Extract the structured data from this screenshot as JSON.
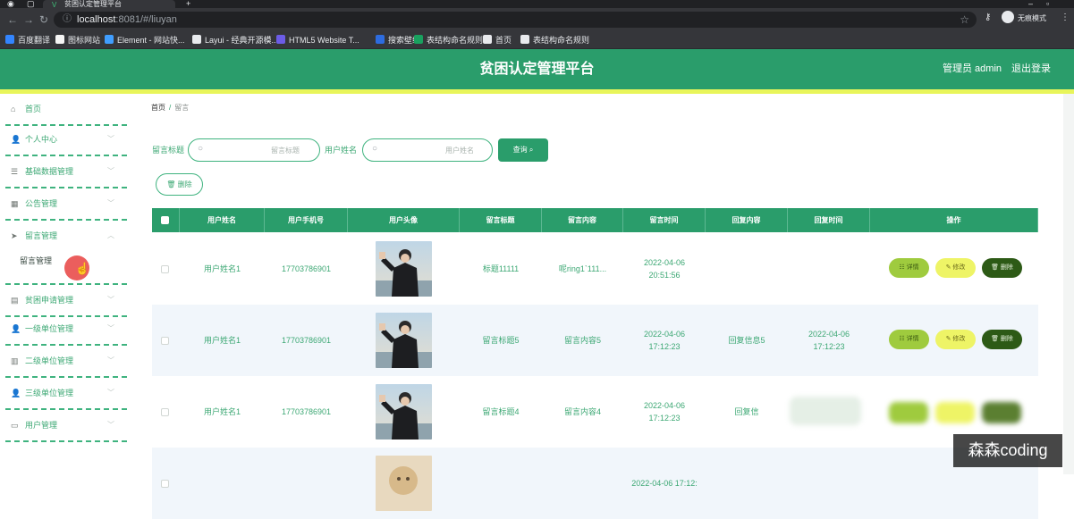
{
  "browser": {
    "tab_title": "贫困认定管理平台",
    "url_host": "localhost",
    "url_path": ":8081/#/liuyan",
    "profile_label": "无痕模式",
    "bookmarks": [
      {
        "label": "百度翻译",
        "color": "#3385ff"
      },
      {
        "label": "图标网站",
        "color": "#f5f5f5"
      },
      {
        "label": "Element - 网站快...",
        "color": "#409eff"
      },
      {
        "label": "Layui - 经典开源模...",
        "color": "#e8eaed"
      },
      {
        "label": "HTML5 Website T...",
        "color": "#6c5ce7"
      },
      {
        "label": "搜索壁纸",
        "color": "#2d6cdf"
      },
      {
        "label": "表结构命名规则",
        "color": "#19a15f"
      },
      {
        "label": "首页",
        "color": "#e8eaed"
      },
      {
        "label": "表结构命名规则",
        "color": "#e8eaed"
      }
    ]
  },
  "header": {
    "title": "贫困认定管理平台",
    "user": "管理员 admin",
    "logout": "退出登录",
    "primary_color": "#2a9d6b",
    "accent_strip_color": "#e8f55a"
  },
  "sidebar": {
    "items": [
      {
        "label": "首页",
        "icon": "home-icon",
        "glyph": "⌂",
        "has_chevron": false
      },
      {
        "label": "个人中心",
        "icon": "user-icon",
        "glyph": "👤",
        "has_chevron": true
      },
      {
        "label": "基础数据管理",
        "icon": "menu-icon",
        "glyph": "☰",
        "has_chevron": true
      },
      {
        "label": "公告管理",
        "icon": "grid-icon",
        "glyph": "▦",
        "has_chevron": true
      },
      {
        "label": "留言管理",
        "icon": "send-icon",
        "glyph": "➤",
        "has_chevron": true
      },
      {
        "label": "贫困申请管理",
        "icon": "document-icon",
        "glyph": "▤",
        "has_chevron": true
      },
      {
        "label": "一级单位管理",
        "icon": "user-icon",
        "glyph": "👤",
        "has_chevron": true
      },
      {
        "label": "二级单位管理",
        "icon": "chart-icon",
        "glyph": "▥",
        "has_chevron": true
      },
      {
        "label": "三级单位管理",
        "icon": "user-icon",
        "glyph": "👤",
        "has_chevron": true
      },
      {
        "label": "用户管理",
        "icon": "chat-icon",
        "glyph": "▭",
        "has_chevron": true
      }
    ],
    "active_sub": "留言管理"
  },
  "breadcrumb": {
    "home": "首页",
    "separator": "/",
    "current": "留言"
  },
  "search": {
    "field1_label": "留言标题",
    "field1_placeholder": "留言标题",
    "field2_label": "用户姓名",
    "field2_placeholder": "用户姓名",
    "query_button": "查询",
    "delete_button": "删除"
  },
  "table": {
    "columns": [
      "用户姓名",
      "用户手机号",
      "用户头像",
      "留言标题",
      "留言内容",
      "留言时间",
      "回复内容",
      "回复时间",
      "操作"
    ],
    "rows": [
      {
        "name": "用户姓名1",
        "phone": "17703786901",
        "title": "标题11111",
        "content": "呢ring1`111...",
        "time": "2022-04-06 20:51:56",
        "reply": "",
        "reply_time": ""
      },
      {
        "name": "用户姓名1",
        "phone": "17703786901",
        "title": "留言标题5",
        "content": "留言内容5",
        "time": "2022-04-06 17:12:23",
        "reply": "回复信息5",
        "reply_time": "2022-04-06 17:12:23"
      },
      {
        "name": "用户姓名1",
        "phone": "17703786901",
        "title": "留言标题4",
        "content": "留言内容4",
        "time": "2022-04-06 17:12:23",
        "reply": "回复信",
        "reply_time": ""
      },
      {
        "name": "",
        "phone": "",
        "title": "",
        "content": "",
        "time": "2022-04-06 17:12:",
        "reply": "",
        "reply_time": ""
      }
    ],
    "actions": {
      "detail": "详情",
      "edit": "修改",
      "delete": "删除"
    }
  },
  "watermark": "森森coding"
}
